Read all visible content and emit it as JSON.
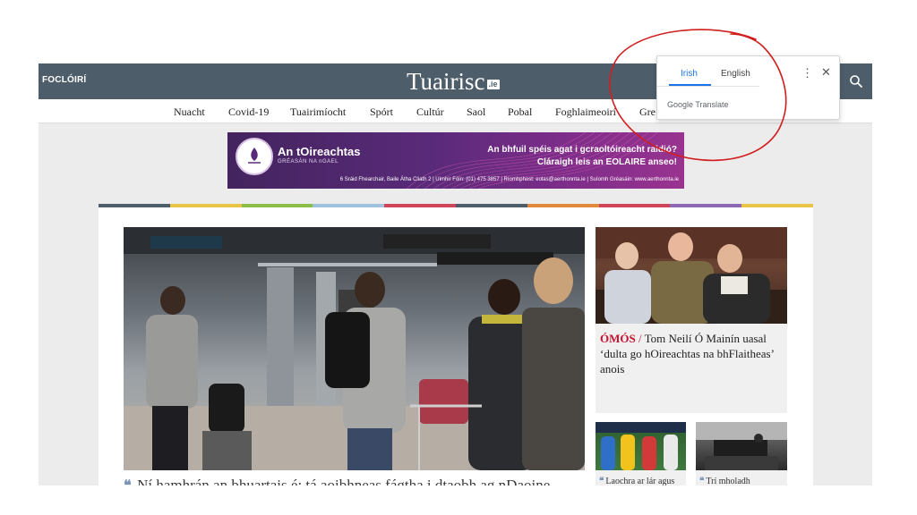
{
  "header": {
    "focloiri_label": "FOCLÓIRÍ",
    "logo_text": "Tuairisc",
    "logo_suffix": ".ie",
    "search_icon": "search-icon"
  },
  "nav": {
    "items": [
      "Nuacht",
      "Covid-19",
      "Tuairimíocht",
      "Spórt",
      "Cultúr",
      "Saol",
      "Pobal",
      "Foghlaimeoirí",
      "Gre"
    ]
  },
  "ad": {
    "brand": "An tOireachtas",
    "brand_sub": "GRÉASÁN NA nGAEL",
    "line1": "An bhfuil spéis agat i gcraoltóireacht raidió?",
    "line2": "Cláraigh leis an EOLAIRE anseo!",
    "footer": "6 Sráid Fhearchair, Baile Átha Cliath 2 | Uimhir Fóin: (01) 475 3857 | Ríomhphost: eolas@aerthonnta.ie | Suíomh Gréasáin: www.aerthonnta.ie"
  },
  "stripe_colors": [
    "#4d5e6a",
    "#e8c547",
    "#8cbf4a",
    "#9fc2dd",
    "#d0455a",
    "#4d5e6a",
    "#e18a3b",
    "#d0455a",
    "#8d69b3",
    "#e8c547"
  ],
  "main_story": {
    "caption": "Ní hamhrán an bhuartais é; tá aoibhneas fágtha i dtaobh ag nDaoine"
  },
  "side_story": {
    "kicker": "ÓMÓS",
    "separator": " / ",
    "title": "Tom Neilí Ó Mainín uasal ‘dulta go hOireachtas na bhFlaitheas’ anois"
  },
  "tiles": [
    {
      "quote": "❝",
      "text": "Laochra ar lár agus"
    },
    {
      "quote": "❝",
      "text": "Trí mholadh"
    }
  ],
  "translate": {
    "lang_source": "Irish",
    "lang_target": "English",
    "more_icon": "⋮",
    "close_icon": "✕",
    "brand": "Google Translate"
  },
  "colors": {
    "header_bg": "#4d5e6a",
    "kicker": "#c8102e",
    "translate_accent": "#1a73e8",
    "annotation_red": "#d11f1f"
  }
}
